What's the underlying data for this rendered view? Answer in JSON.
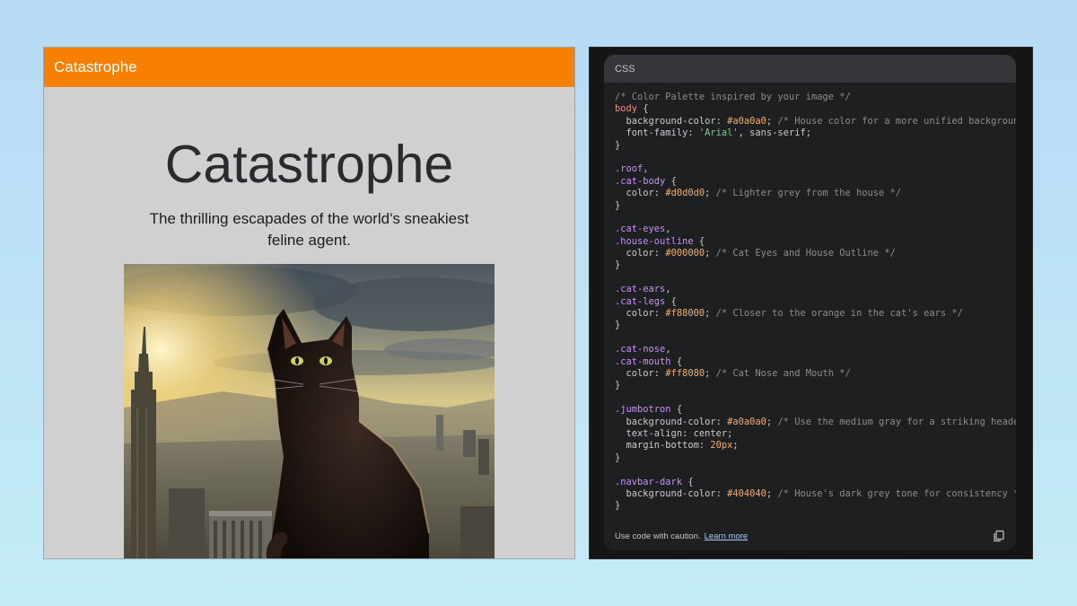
{
  "site": {
    "brand": "Catastrophe",
    "title": "Catastrophe",
    "tagline": "The thrilling escapades of the world's sneakiest feline agent.",
    "navbar_color": "#f78003",
    "background_color": "#d0d0d0"
  },
  "code_block": {
    "language": "CSS",
    "footer_text": "Use code with caution.",
    "learn_more": "Learn more",
    "copy_icon": "copy-icon",
    "lines": [
      [
        [
          "tok-comment",
          "/* Color Palette inspired by your image */"
        ]
      ],
      [
        [
          "tok-tag",
          "body"
        ],
        [
          "tok-plain",
          " {"
        ]
      ],
      [
        [
          "tok-prop",
          "  background-color: "
        ],
        [
          "tok-number",
          "#a0a0a0"
        ],
        [
          "tok-plain",
          "; "
        ],
        [
          "tok-comment",
          "/* House color for a more unified background */"
        ]
      ],
      [
        [
          "tok-prop",
          "  font-family: "
        ],
        [
          "tok-string",
          "'Arial'"
        ],
        [
          "tok-plain",
          ", sans-serif;"
        ]
      ],
      [
        [
          "tok-plain",
          "}"
        ]
      ],
      [
        [
          "tok-plain",
          ""
        ]
      ],
      [
        [
          "tok-selector",
          ".roof"
        ],
        [
          "tok-plain",
          ","
        ]
      ],
      [
        [
          "tok-selector",
          ".cat-body"
        ],
        [
          "tok-plain",
          " {"
        ]
      ],
      [
        [
          "tok-prop",
          "  color: "
        ],
        [
          "tok-number",
          "#d0d0d0"
        ],
        [
          "tok-plain",
          "; "
        ],
        [
          "tok-comment",
          "/* Lighter grey from the house */"
        ]
      ],
      [
        [
          "tok-plain",
          "}"
        ]
      ],
      [
        [
          "tok-plain",
          ""
        ]
      ],
      [
        [
          "tok-selector",
          ".cat-eyes"
        ],
        [
          "tok-plain",
          ","
        ]
      ],
      [
        [
          "tok-selector",
          ".house-outline"
        ],
        [
          "tok-plain",
          " {"
        ]
      ],
      [
        [
          "tok-prop",
          "  color: "
        ],
        [
          "tok-number",
          "#000000"
        ],
        [
          "tok-plain",
          "; "
        ],
        [
          "tok-comment",
          "/* Cat Eyes and House Outline */"
        ]
      ],
      [
        [
          "tok-plain",
          "}"
        ]
      ],
      [
        [
          "tok-plain",
          ""
        ]
      ],
      [
        [
          "tok-selector",
          ".cat-ears"
        ],
        [
          "tok-plain",
          ","
        ]
      ],
      [
        [
          "tok-selector",
          ".cat-legs"
        ],
        [
          "tok-plain",
          " {"
        ]
      ],
      [
        [
          "tok-prop",
          "  color: "
        ],
        [
          "tok-number",
          "#f88000"
        ],
        [
          "tok-plain",
          "; "
        ],
        [
          "tok-comment",
          "/* Closer to the orange in the cat's ears */"
        ]
      ],
      [
        [
          "tok-plain",
          "}"
        ]
      ],
      [
        [
          "tok-plain",
          ""
        ]
      ],
      [
        [
          "tok-selector",
          ".cat-nose"
        ],
        [
          "tok-plain",
          ","
        ]
      ],
      [
        [
          "tok-selector",
          ".cat-mouth"
        ],
        [
          "tok-plain",
          " {"
        ]
      ],
      [
        [
          "tok-prop",
          "  color: "
        ],
        [
          "tok-number",
          "#ff8080"
        ],
        [
          "tok-plain",
          "; "
        ],
        [
          "tok-comment",
          "/* Cat Nose and Mouth */"
        ]
      ],
      [
        [
          "tok-plain",
          "}"
        ]
      ],
      [
        [
          "tok-plain",
          ""
        ]
      ],
      [
        [
          "tok-selector",
          ".jumbotron"
        ],
        [
          "tok-plain",
          " {"
        ]
      ],
      [
        [
          "tok-prop",
          "  background-color: "
        ],
        [
          "tok-number",
          "#a0a0a0"
        ],
        [
          "tok-plain",
          "; "
        ],
        [
          "tok-comment",
          "/* Use the medium gray for a striking header */"
        ]
      ],
      [
        [
          "tok-prop",
          "  text-align: center;"
        ]
      ],
      [
        [
          "tok-prop",
          "  margin-bottom: "
        ],
        [
          "tok-number",
          "20px"
        ],
        [
          "tok-plain",
          ";"
        ]
      ],
      [
        [
          "tok-plain",
          "}"
        ]
      ],
      [
        [
          "tok-plain",
          ""
        ]
      ],
      [
        [
          "tok-selector",
          ".navbar-dark"
        ],
        [
          "tok-plain",
          " {"
        ]
      ],
      [
        [
          "tok-prop",
          "  background-color: "
        ],
        [
          "tok-number",
          "#404040"
        ],
        [
          "tok-plain",
          "; "
        ],
        [
          "tok-comment",
          "/* House's dark grey tone for consistency */"
        ]
      ],
      [
        [
          "tok-plain",
          "}"
        ]
      ]
    ]
  }
}
